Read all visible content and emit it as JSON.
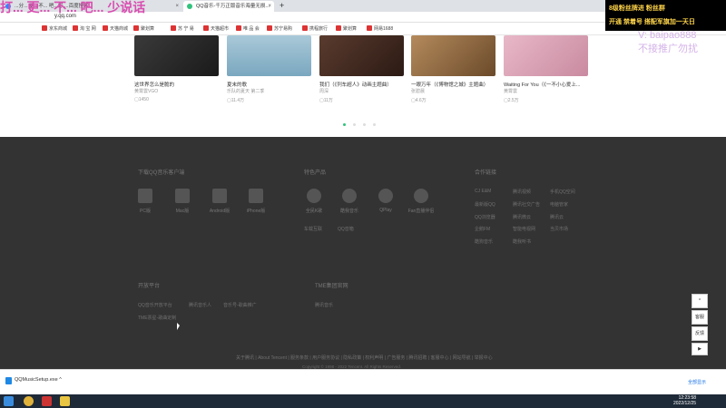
{
  "browser": {
    "tabs": [
      {
        "label": "...分... 更...不... 吧...好....百度搜索",
        "active": false
      },
      {
        "label": "QQ音乐-千万正版音乐海量无损...",
        "active": true
      }
    ],
    "new_tab": "+",
    "url": "y.qq.com",
    "bookmarks": [
      "京东商城",
      "淘 宝 网",
      "天猫商城",
      "聚划算",
      "苏 宁 易",
      "天猫超市",
      "唯 品 会",
      "苏宁易购",
      "携程旅行",
      "聚划算",
      "网易1688"
    ]
  },
  "cards": [
    {
      "title": "这世界怎么是脆的",
      "singer": "黄霄雲VGO",
      "plays": "1450"
    },
    {
      "title": "夏末的歌",
      "singer": "乐队的夏天 第二季",
      "plays": "11.4万"
    },
    {
      "title": "我们（《列车超人》动画主题曲）",
      "singer": "周深",
      "plays": "11万"
    },
    {
      "title": "一眼万年（《博物馆之城》主题曲）",
      "singer": "张碧晨",
      "plays": "4.6万"
    },
    {
      "title": "Waiting For You（《一不小心爱上...",
      "singer": "黄霄雲",
      "plays": "2.5万"
    }
  ],
  "footer": {
    "download_title": "下载QQ音乐客户端",
    "clients": [
      "PC版",
      "Mac版",
      "Android版",
      "iPhone版"
    ],
    "features_title": "特色产品",
    "features": [
      "全民K歌",
      "酷我音乐",
      "QPlay",
      "Fan直播伴侣",
      "车载互联",
      "QQ音箱"
    ],
    "partners_title": "合作链接",
    "partners": [
      "CJ E&M",
      "腾讯视频",
      "手机QQ空间",
      "最新版QQ",
      "腾讯社交广告",
      "电脑管家",
      "QQ浏览器",
      "腾讯微云",
      "腾讯云",
      "企鹅FM",
      "智能电视网",
      "当贝市场",
      "酷狗音乐",
      "酷我听书"
    ],
    "open_title": "开放平台",
    "open_links": [
      "QQ音乐开放平台",
      "腾讯音乐人",
      "音乐号-歌曲推广",
      "TME票星-歌曲定制"
    ],
    "group_title": "TME集团官网",
    "group_links": [
      "腾讯音乐"
    ],
    "bottom_links": "关于腾讯 | About Tencent | 服务条款 | 用户服务协议 | 隐私政策 | 权利声明 | 广告服务 | 腾讯招聘 | 客服中心 | 网站导航 | 举报中心",
    "copyright": "Copyright © 1998 - 2022 Tencent. All Rights Reserved."
  },
  "float_bar": {
    "up": "^",
    "item1": "客服",
    "item2": "反馈"
  },
  "overlays": {
    "top_left": "打... 更... 不... 吧... 少说话",
    "top_right_1": "8级粉丝牌进 粉丝群",
    "top_right_2": "开通 禁着号 搭配军旗加一天日",
    "right_id": "V: baipao888",
    "right_note": "不接推广勿扰"
  },
  "download": {
    "file": "QQMusicSetup.exe",
    "show_all": "全部显示"
  },
  "taskbar": {
    "time": "12:23:58",
    "date": "2022/12/25"
  },
  "colors": {
    "accent": "#31c27c",
    "footer_bg": "#333333"
  }
}
